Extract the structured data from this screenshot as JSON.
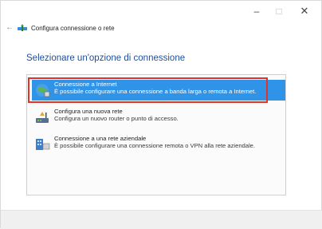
{
  "window": {
    "min_glyph": "–",
    "max_glyph": "□",
    "close_glyph": "✕",
    "back_glyph": "←",
    "title": "Configura connessione o rete"
  },
  "page": {
    "heading": "Selezionare un'opzione di connessione"
  },
  "options": [
    {
      "title": "Connessione a Internet",
      "desc": "È possibile configurare una connessione a banda larga o remota a Internet.",
      "icon": "globe-network-icon",
      "selected": true
    },
    {
      "title": "Configura una nuova rete",
      "desc": "Configura un nuovo router o punto di accesso.",
      "icon": "router-icon",
      "selected": false
    },
    {
      "title": "Connessione a una rete aziendale",
      "desc": "È possibile configurare una connessione remota o VPN alla rete aziendale.",
      "icon": "workplace-icon",
      "selected": false
    }
  ],
  "colors": {
    "heading": "#1f4e9c",
    "selection": "#2f93e8",
    "highlight_border": "#e0332b"
  }
}
